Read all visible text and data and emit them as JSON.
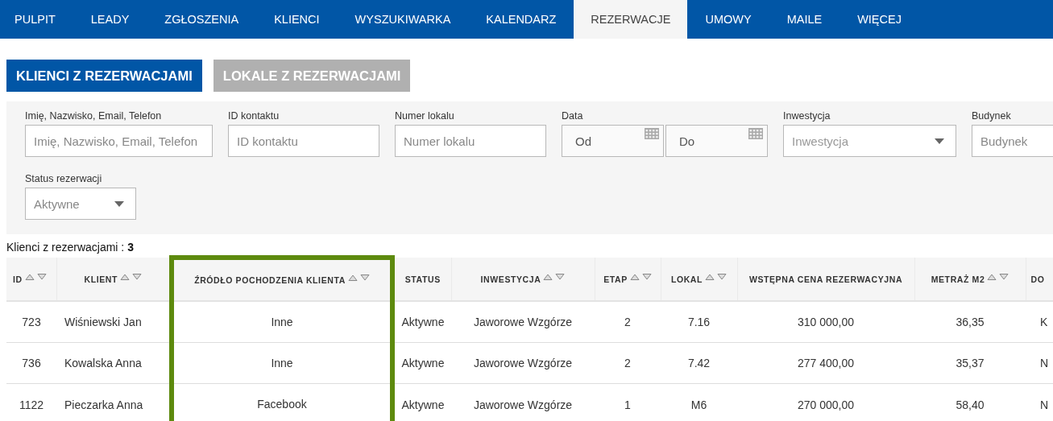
{
  "nav": {
    "items": [
      {
        "label": "PULPIT",
        "selected": false
      },
      {
        "label": "LEADY",
        "selected": false
      },
      {
        "label": "ZGŁOSZENIA",
        "selected": false
      },
      {
        "label": "KLIENCI",
        "selected": false
      },
      {
        "label": "WYSZUKIWARKA",
        "selected": false
      },
      {
        "label": "KALENDARZ",
        "selected": false
      },
      {
        "label": "REZERWACJE",
        "selected": true
      },
      {
        "label": "UMOWY",
        "selected": false
      },
      {
        "label": "MAILE",
        "selected": false
      },
      {
        "label": "WIĘCEJ",
        "selected": false
      }
    ]
  },
  "subtabs": [
    {
      "label": "KLIENCI Z REZERWACJAMI",
      "selected": true
    },
    {
      "label": "LOKALE Z REZERWACJAMI",
      "selected": false
    }
  ],
  "filters": [
    {
      "kind": "text",
      "label": "Imię, Nazwisko, Email, Telefon",
      "placeholder": "Imię, Nazwisko, Email, Telefon"
    },
    {
      "kind": "text",
      "label": "ID kontaktu",
      "placeholder": "ID kontaktu"
    },
    {
      "kind": "text",
      "label": "Numer lokalu",
      "placeholder": "Numer lokalu"
    },
    {
      "kind": "date-range",
      "label": "Data",
      "from": {
        "placeholder": "Od"
      },
      "to": {
        "placeholder": "Do"
      }
    },
    {
      "kind": "select",
      "label": "Inwestycja",
      "placeholder": "Inwestycja"
    },
    {
      "kind": "text",
      "label": "Budynek",
      "placeholder": "Budynek"
    },
    {
      "kind": "select",
      "label": "Status rezerwacji",
      "value": "Aktywne"
    }
  ],
  "count_text": "Klienci z rezerwacjami : **3**",
  "table": {
    "columns": [
      {
        "label": "ID",
        "sortable": true,
        "highlighted": false
      },
      {
        "label": "KLIENT",
        "sortable": true,
        "highlighted": false
      },
      {
        "label": "ŹRÓDŁO POCHODZENIA KLIENTA",
        "sortable": true,
        "highlighted": true
      },
      {
        "label": "STATUS",
        "sortable": false,
        "highlighted": false
      },
      {
        "label": "INWESTYCJA",
        "sortable": true,
        "highlighted": false
      },
      {
        "label": "ETAP",
        "sortable": true,
        "highlighted": false
      },
      {
        "label": "LOKAL",
        "sortable": true,
        "highlighted": false
      },
      {
        "label": "WSTĘPNA CENA REZERWACYJNA",
        "sortable": false,
        "highlighted": false
      },
      {
        "label": "METRAŻ M2",
        "sortable": true,
        "highlighted": false
      },
      {
        "label": "DO",
        "sortable": false,
        "highlighted": false
      }
    ],
    "rows": [
      [
        "723",
        "Wiśniewski Jan",
        "Inne",
        "Aktywne",
        "Jaworowe Wzgórze",
        "2",
        "7.16",
        "310 000,00",
        "36,35",
        "K"
      ],
      [
        "736",
        "Kowalska Anna",
        "Inne",
        "Aktywne",
        "Jaworowe Wzgórze",
        "2",
        "7.42",
        "277 400,00",
        "35,37",
        "N"
      ],
      [
        "1122",
        "Pieczarka Anna",
        "Facebook",
        "Aktywne",
        "Jaworowe Wzgórze",
        "1",
        "M6",
        "270 000,00",
        "58,40",
        "N"
      ]
    ]
  }
}
